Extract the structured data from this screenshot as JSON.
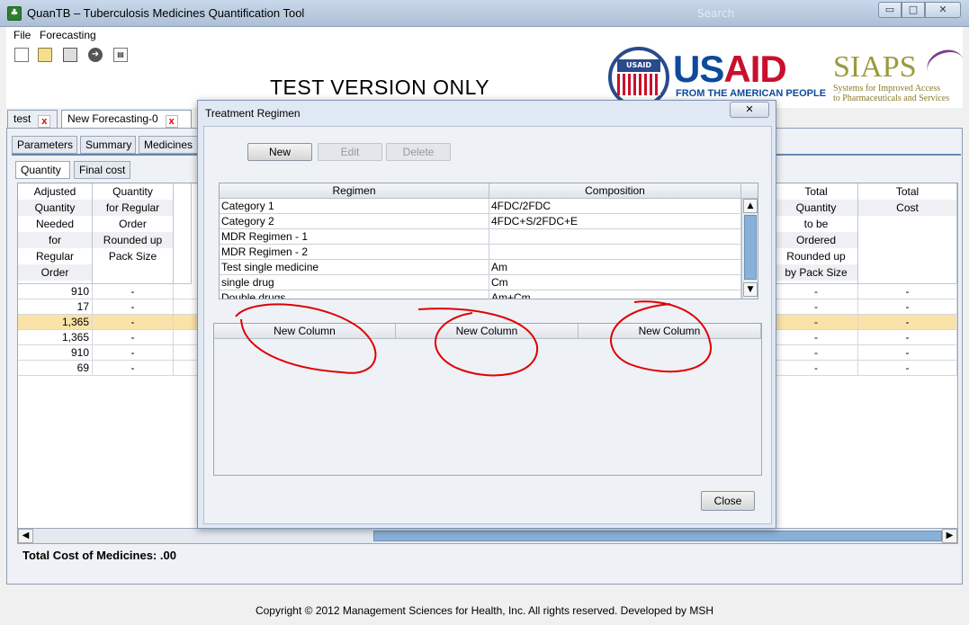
{
  "window": {
    "title": "QuanTB – Tuberculosis Medicines Quantification Tool",
    "search_ghost": "Search",
    "minimize_glyph": "▭",
    "maximize_glyph": "□",
    "close_glyph": "✕"
  },
  "menu": [
    "File",
    "Forecasting"
  ],
  "toolbar": {
    "icons": [
      "new-file-icon",
      "open-folder-icon",
      "save-icon",
      "run-icon",
      "export-icon"
    ],
    "run_glyph": "➜",
    "export_glyph": "▤"
  },
  "banner": {
    "test_version": "TEST VERSION ONLY",
    "usaid_us": "US",
    "usaid_aid": "AID",
    "usaid_sub": "FROM THE AMERICAN PEOPLE",
    "seal_text": "USAID",
    "siaps": "SIAPS",
    "siaps_sub1": "Systems for Improved Access",
    "siaps_sub2": "to Pharmaceuticals and Services"
  },
  "doc_tabs": [
    {
      "label": "test",
      "close": "x"
    },
    {
      "label": "New Forecasting-0",
      "close": "x"
    }
  ],
  "sub_tabs": [
    "Parameters",
    "Summary",
    "Medicines"
  ],
  "sub2_tabs": [
    "Quantity",
    "Final cost"
  ],
  "grid": {
    "headers": {
      "adjusted": [
        "Adjusted",
        "Quantity",
        "Needed",
        "for",
        "Regular",
        "Order"
      ],
      "quantity_regular": [
        "Quantity",
        "for Regular",
        "Order",
        "Rounded up",
        "Pack Size"
      ],
      "total_quantity": [
        "Total",
        "Quantity",
        "to be",
        "Ordered",
        "Rounded up",
        "by Pack Size"
      ],
      "total_cost": [
        "Total",
        "Cost"
      ]
    },
    "rows": [
      {
        "adjusted": "910",
        "regular": "-",
        "total_qty": "-",
        "total_cost": "-"
      },
      {
        "adjusted": "17",
        "regular": "-",
        "total_qty": "-",
        "total_cost": "-"
      },
      {
        "adjusted": "1,365",
        "regular": "-",
        "total_qty": "-",
        "total_cost": "-"
      },
      {
        "adjusted": "1,365",
        "regular": "-",
        "total_qty": "-",
        "total_cost": "-"
      },
      {
        "adjusted": "910",
        "regular": "-",
        "total_qty": "-",
        "total_cost": "-"
      },
      {
        "adjusted": "69",
        "regular": "-",
        "total_qty": "-",
        "total_cost": "-"
      }
    ],
    "selected_row": 2,
    "scroll_left": "◀",
    "scroll_right": "▶"
  },
  "total_cost_label": "Total Cost of Medicines: .00",
  "copyright": "Copyright © 2012 Management Sciences for Health, Inc. All rights reserved. Developed by MSH",
  "dialog": {
    "title": "Treatment Regimen",
    "close_glyph": "✕",
    "buttons": {
      "new": "New",
      "edit": "Edit",
      "delete": "Delete",
      "close": "Close"
    },
    "regimen_table": {
      "headers": [
        "Regimen",
        "Composition"
      ],
      "rows": [
        [
          "Category 1",
          "4FDC/2FDC"
        ],
        [
          "Category 2",
          "4FDC+S/2FDC+E"
        ],
        [
          "MDR Regimen - 1",
          ""
        ],
        [
          "MDR Regimen - 2",
          ""
        ],
        [
          "Test single medicine",
          "Am"
        ],
        [
          "single drug",
          "Cm"
        ],
        [
          "Double drugs",
          "Am+Cm"
        ]
      ],
      "scroll_up": "▲",
      "scroll_down": "▼"
    },
    "new_columns": [
      "New Column",
      "New Column",
      "New Column"
    ]
  },
  "colors": {
    "selected_row": "#fbe2a8",
    "annotation": "#e00000",
    "usaid_blue": "#0d4a9c",
    "usaid_red": "#c8102e",
    "scroll_thumb": "#8ab0d8"
  }
}
